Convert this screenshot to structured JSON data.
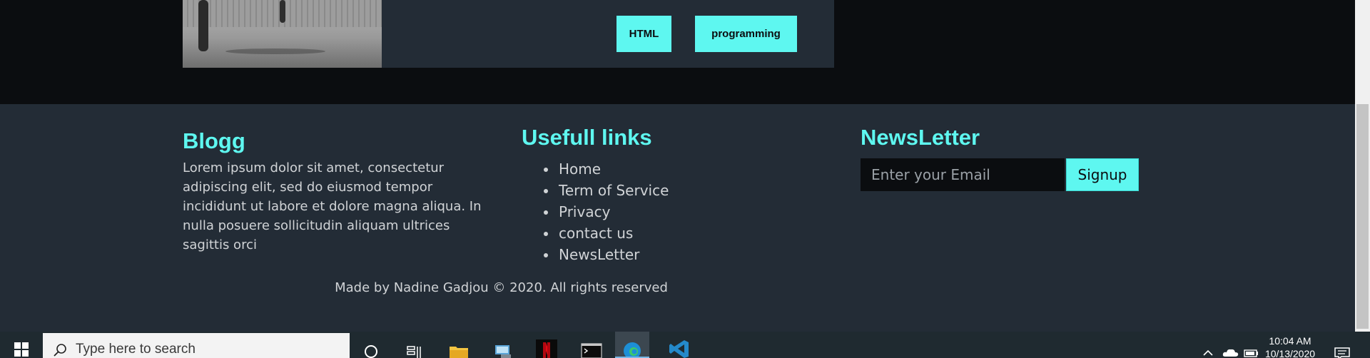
{
  "post": {
    "tags": [
      "HTML",
      "programming"
    ]
  },
  "footer": {
    "blog": {
      "title": "Blogg",
      "text": "Lorem ipsum dolor sit amet, consectetur adipiscing elit, sed do eiusmod tempor incididunt ut labore et dolore magna aliqua. In nulla posuere sollicitudin aliquam ultrices sagittis orci"
    },
    "links": {
      "title": "Usefull links",
      "items": [
        "Home",
        "Term of Service",
        "Privacy",
        "contact us",
        "NewsLetter"
      ]
    },
    "newsletter": {
      "title": "NewsLetter",
      "email_placeholder": "Enter your Email",
      "signup_label": "Signup"
    },
    "copyright": "Made by Nadine Gadjou © 2020. All rights reserved"
  },
  "colors": {
    "accent": "#5ef7f0",
    "footer_bg": "#232c36",
    "page_bg": "#0b0d10"
  },
  "taskbar": {
    "search_placeholder": "Type here to search",
    "time": "10:04 AM",
    "date": "10/13/2020",
    "apps": [
      "cortana-icon",
      "task-view-icon",
      "file-explorer-icon",
      "network-pc-icon",
      "netflix-icon",
      "terminal-icon",
      "edge-icon",
      "vscode-icon"
    ],
    "tray": [
      "chevron-up-icon",
      "onedrive-icon",
      "battery-icon",
      "notifications-icon"
    ]
  }
}
